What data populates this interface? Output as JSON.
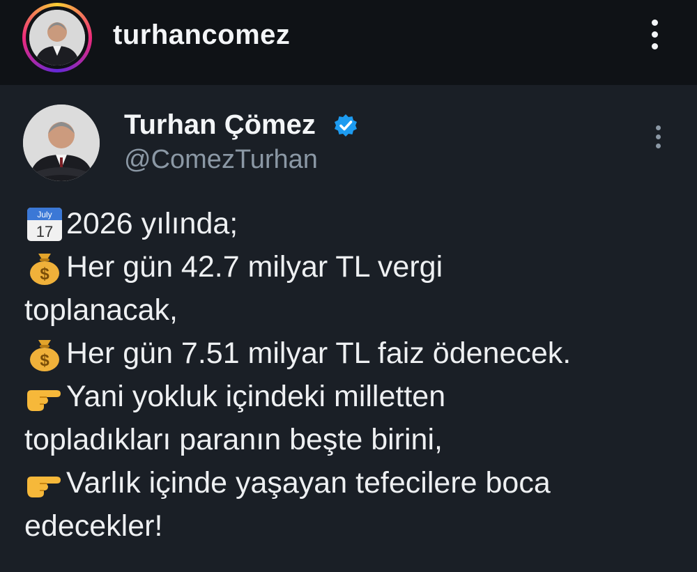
{
  "instagram": {
    "username": "turhancomez",
    "avatar_icon": "profile-photo",
    "menu_icon": "more-vertical-icon"
  },
  "tweet": {
    "author_name": "Turhan Çömez",
    "handle": "@ComezTurhan",
    "verified_icon": "verified-badge-icon",
    "menu_icon": "more-vertical-icon",
    "lines": [
      {
        "emoji": "calendar-icon",
        "text": "2026 yılında;"
      },
      {
        "emoji": "money-bag-icon",
        "text": "Her gün 42.7 milyar TL vergi"
      },
      {
        "emoji": "",
        "text": "toplanacak,"
      },
      {
        "emoji": "money-bag-icon",
        "text": "Her gün 7.51 milyar TL faiz ödenecek."
      },
      {
        "emoji": "pointing-hand-icon",
        "text": "Yani yokluk içindeki milletten"
      },
      {
        "emoji": "",
        "text": "topladıkları paranın beşte birini,"
      },
      {
        "emoji": "pointing-hand-icon",
        "text": "Varlık içinde yaşayan tefecilere boca"
      },
      {
        "emoji": "",
        "text": "edecekler!"
      }
    ],
    "calendar_emoji_month": "July",
    "calendar_emoji_day": "17"
  },
  "colors": {
    "header_bg": "#0f1216",
    "tweet_bg": "#1a1f26",
    "verified_blue": "#1d9bf0",
    "handle_gray": "#8b98a5"
  }
}
